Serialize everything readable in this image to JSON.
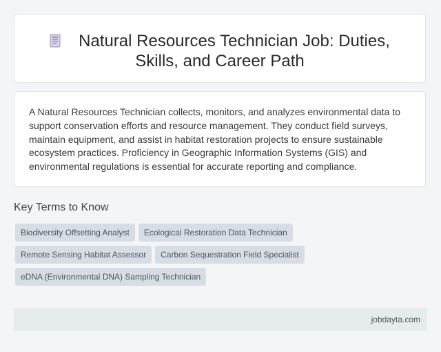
{
  "header": {
    "icon": "document-icon",
    "title_line1": "Natural Resources Technician Job: Duties,",
    "title_line2": "Skills, and Career Path"
  },
  "summary": {
    "text": "A Natural Resources Technician collects, monitors, and analyzes environmental data to support conservation efforts and resource management. They conduct field surveys, maintain equipment, and assist in habitat restoration projects to ensure sustainable ecosystem practices. Proficiency in Geographic Information Systems (GIS) and environmental regulations is essential for accurate reporting and compliance."
  },
  "key_terms": {
    "heading": "Key Terms to Know",
    "items": [
      "Biodiversity Offsetting Analyst",
      "Ecological Restoration Data Technician",
      "Remote Sensing Habitat Assessor",
      "Carbon Sequestration Field Specialist",
      "eDNA (Environmental DNA) Sampling Technician"
    ]
  },
  "footer": {
    "site": "jobdayta.com"
  },
  "colors": {
    "background": "#f3f5f7",
    "tag_background": "#d7dde4",
    "footer_background": "#e6ebee"
  }
}
